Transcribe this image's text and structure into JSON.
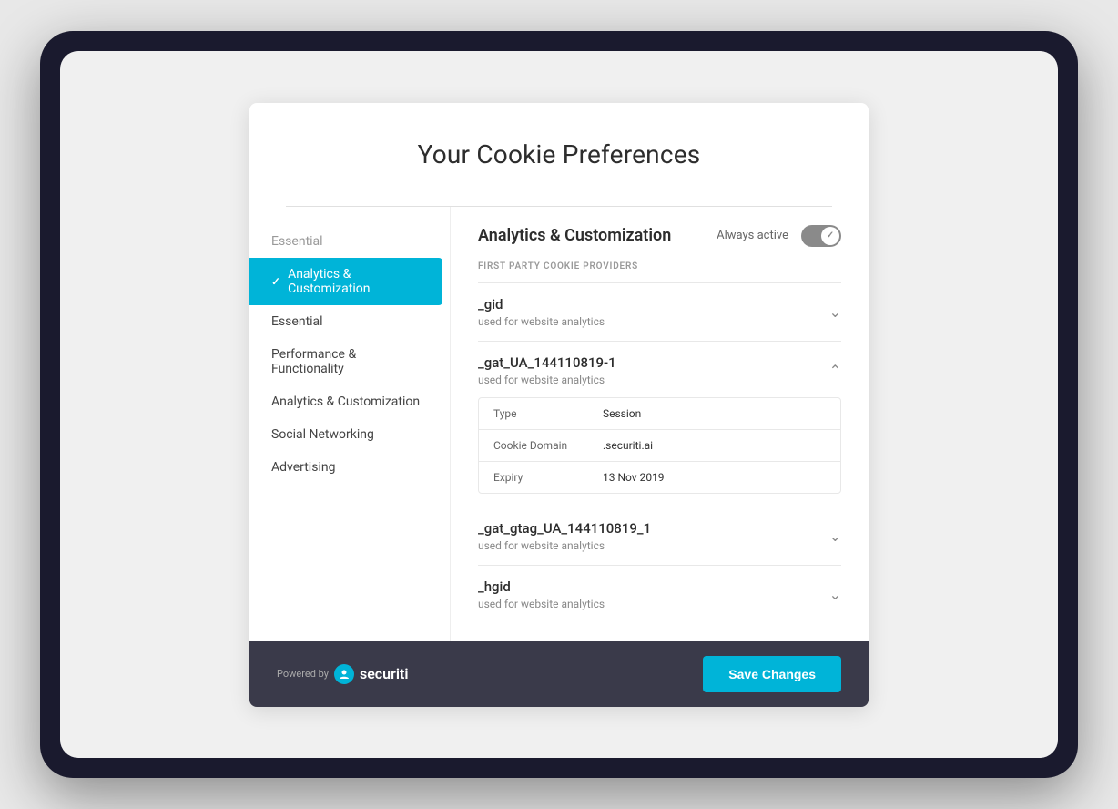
{
  "modal": {
    "title": "Your Cookie Preferences",
    "divider": true
  },
  "sidebar": {
    "items": [
      {
        "id": "essential-top",
        "label": "Essential",
        "active": false,
        "muted": true
      },
      {
        "id": "analytics-customization",
        "label": "Analytics & Customization",
        "active": true
      },
      {
        "id": "essential",
        "label": "Essential",
        "active": false
      },
      {
        "id": "performance-functionality",
        "label": "Performance & Functionality",
        "active": false
      },
      {
        "id": "analytics-customization-2",
        "label": "Analytics & Customization",
        "active": false
      },
      {
        "id": "social-networking",
        "label": "Social Networking",
        "active": false
      },
      {
        "id": "advertising",
        "label": "Advertising",
        "active": false
      }
    ]
  },
  "panel": {
    "title": "Analytics & Customization",
    "always_active_label": "Always active",
    "section_label": "FIRST PARTY COOKIE PROVIDERS",
    "cookies": [
      {
        "id": "gid",
        "name": "_gid",
        "description": "used for website analytics",
        "expanded": false
      },
      {
        "id": "gat_ua",
        "name": "_gat_UA_144110819-1",
        "description": "used for website analytics",
        "expanded": true,
        "details": [
          {
            "label": "Type",
            "value": "Session"
          },
          {
            "label": "Cookie Domain",
            "value": ".securiti.ai"
          },
          {
            "label": "Expiry",
            "value": "13 Nov 2019"
          }
        ]
      },
      {
        "id": "gat_gtag",
        "name": "_gat_gtag_UA_144110819_1",
        "description": "used for website analytics",
        "expanded": false
      },
      {
        "id": "hgid",
        "name": "_hgid",
        "description": "used for website analytics",
        "expanded": false
      }
    ]
  },
  "footer": {
    "powered_by_label": "Powered by",
    "brand_name": "securiti",
    "save_button_label": "Save Changes"
  }
}
